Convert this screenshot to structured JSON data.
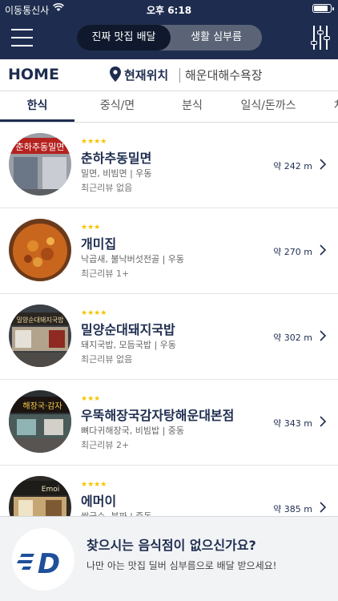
{
  "status": {
    "carrier": "이동통신사",
    "time": "오후 6:18",
    "battery_level": 0.92
  },
  "nav": {
    "segment_on": "진짜 맛집 배달",
    "segment_off": "생활 심부름"
  },
  "location": {
    "home": "HOME",
    "current": "현재위치",
    "address": "해운대해수욕장"
  },
  "tabs": [
    "한식",
    "중식/면",
    "분식",
    "일식/돈까스",
    "치"
  ],
  "restaurants": [
    {
      "stars": "★★★★",
      "name": "춘하추동밀면",
      "category": "밀면, 비빔면 | 우동",
      "review": "최근리뷰 없음",
      "distance": "약 242 m",
      "sign": "춘하추동밀면"
    },
    {
      "stars": "★★★",
      "name": "개미집",
      "category": "낙곱새, 불낙버섯전골 | 우동",
      "review": "최근리뷰 1+",
      "distance": "약 270 m"
    },
    {
      "stars": "★★★★",
      "name": "밀양순대돼지국밥",
      "category": "돼지국밥, 모듬국밥 | 우동",
      "review": "최근리뷰 없음",
      "distance": "약 302 m",
      "sign": "밀양순대돼지국밥"
    },
    {
      "stars": "★★★",
      "name": "우뚝해장국감자탕해운대본점",
      "category": "뼈다귀해장국, 비빔밥 | 중동",
      "review": "최근리뷰 2+",
      "distance": "약 343 m",
      "sign": "해장국·감자"
    },
    {
      "stars": "★★★★",
      "name": "에머이",
      "category": "쌀국수, 분짜 | 중동",
      "review": "",
      "distance": "약 385 m",
      "sign": "Emoi"
    }
  ],
  "banner": {
    "title": "찾으시는 음식점이 없으신가요?",
    "subtitle": "나만 아는 맛집 딜버 심부름으로 배달 받으세요!",
    "logo_letter": "D"
  }
}
